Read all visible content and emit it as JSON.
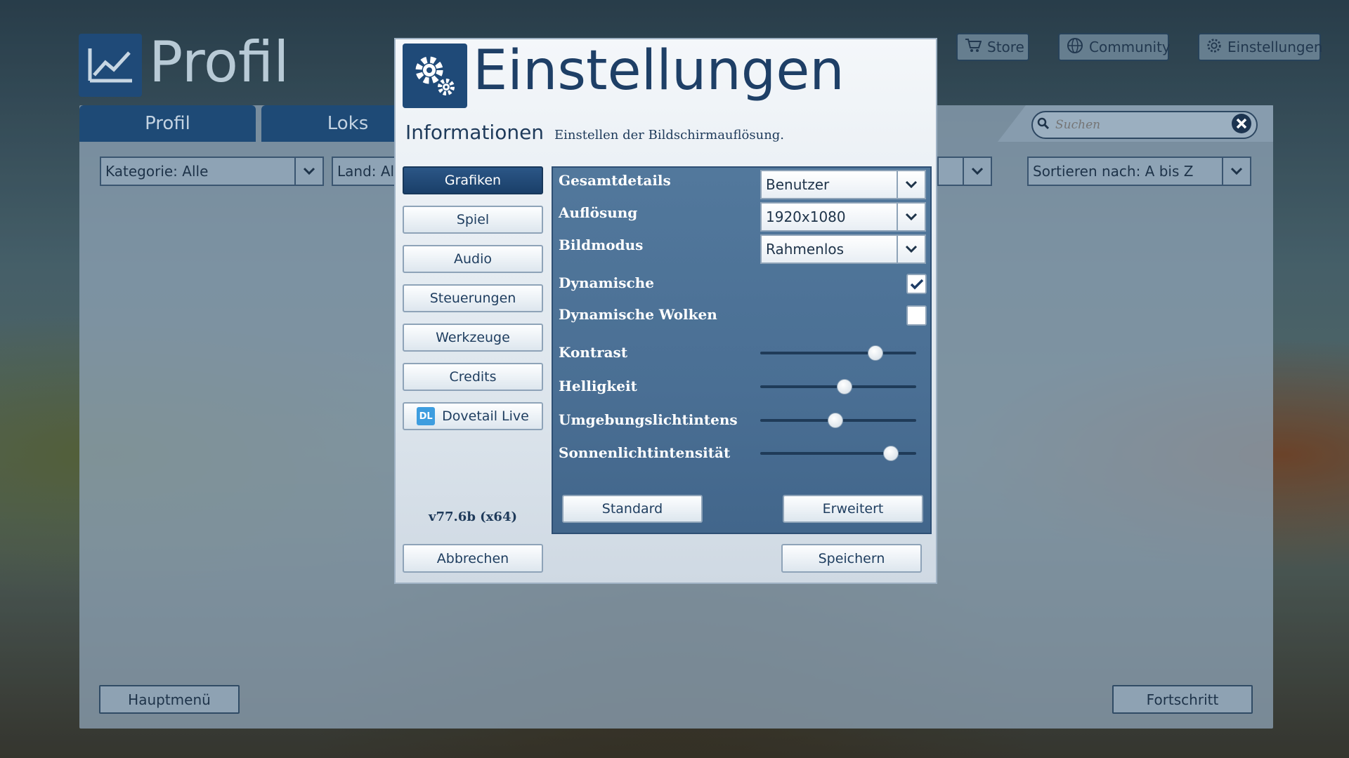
{
  "background": {
    "title": "Profil",
    "top_buttons": [
      {
        "label": "Store",
        "icon": "cart-icon"
      },
      {
        "label": "Community",
        "icon": "globe-icon"
      },
      {
        "label": "Einstellungen",
        "icon": "gear-icon"
      }
    ],
    "tabs": [
      "Profil",
      "Loks"
    ],
    "search_placeholder": "Suchen",
    "filters": {
      "category": "Kategorie: Alle",
      "country": "Land: Alle",
      "sort": "Sortieren nach: A bis Z"
    },
    "main_menu_label": "Hauptmenü",
    "progress_label": "Fortschritt"
  },
  "dialog": {
    "title": "Einstellungen",
    "info_label": "Informationen",
    "info_text": "Einstellen der Bildschirmauflösung.",
    "nav": [
      "Grafiken",
      "Spiel",
      "Audio",
      "Steuerungen",
      "Werkzeuge",
      "Credits",
      "Dovetail Live"
    ],
    "active_nav": "Grafiken",
    "version": "v77.6b (x64)",
    "settings": {
      "overall_details": {
        "label": "Gesamtdetails",
        "value": "Benutzer"
      },
      "resolution": {
        "label": "Auflösung",
        "value": "1920x1080"
      },
      "display_mode": {
        "label": "Bildmodus",
        "value": "Rahmenlos"
      },
      "dynamic": {
        "label": "Dynamische",
        "checked": true
      },
      "dynamic_clouds": {
        "label": "Dynamische Wolken",
        "checked": false
      },
      "contrast": {
        "label": "Kontrast",
        "value": 0.74
      },
      "brightness": {
        "label": "Helligkeit",
        "value": 0.54
      },
      "ambient": {
        "label": "Umgebungslichtintens",
        "value": 0.48
      },
      "sunlight": {
        "label": "Sonnenlichtintensität",
        "value": 0.84
      }
    },
    "default_label": "Standard",
    "advanced_label": "Erweitert",
    "cancel_label": "Abbrechen",
    "save_label": "Speichern"
  }
}
